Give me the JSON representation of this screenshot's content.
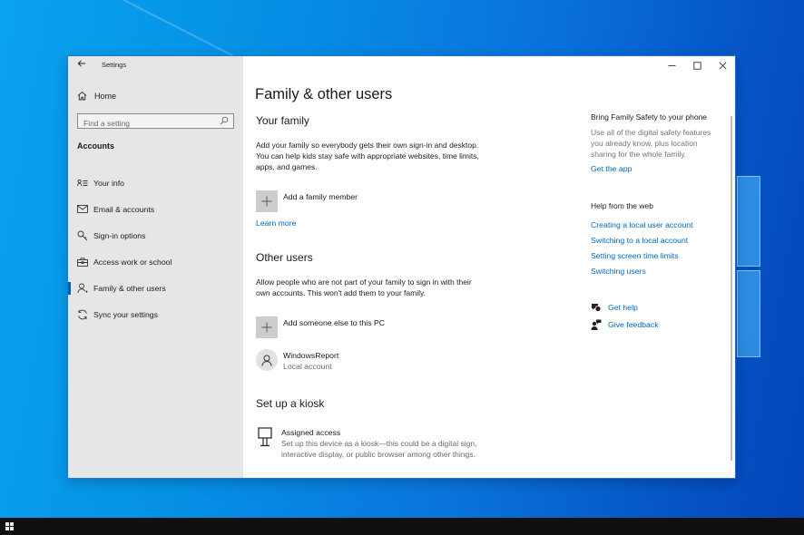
{
  "window": {
    "title": "Settings",
    "controls": {
      "minimize": "minimize",
      "maximize": "maximize",
      "close": "close"
    }
  },
  "sidebar": {
    "home_label": "Home",
    "search": {
      "placeholder": "Find a setting",
      "value": ""
    },
    "section_label": "Accounts",
    "items": [
      {
        "label": "Your info",
        "icon": "contact-info-icon",
        "active": false
      },
      {
        "label": "Email & accounts",
        "icon": "mail-icon",
        "active": false
      },
      {
        "label": "Sign-in options",
        "icon": "key-icon",
        "active": false
      },
      {
        "label": "Access work or school",
        "icon": "briefcase-icon",
        "active": false
      },
      {
        "label": "Family & other users",
        "icon": "person-add-icon",
        "active": true
      },
      {
        "label": "Sync your settings",
        "icon": "sync-icon",
        "active": false
      }
    ],
    "accent_color": "#0063b1"
  },
  "main": {
    "page_title": "Family & other users",
    "your_family": {
      "heading": "Your family",
      "description_lines": [
        "Add your family so everybody gets their own sign-in and desktop.",
        "You can help kids stay safe with appropriate websites, time limits,",
        "apps, and games."
      ],
      "add_label": "Add a family member",
      "learn_more": "Learn more"
    },
    "other_users": {
      "heading": "Other users",
      "description_lines": [
        "Allow people who are not part of your family to sign in with their",
        "own accounts. This won't add them to your family."
      ],
      "add_label": "Add someone else to this PC",
      "users": [
        {
          "name": "WindowsReport",
          "type": "Local account"
        }
      ]
    },
    "kiosk": {
      "heading": "Set up a kiosk",
      "item_title": "Assigned access",
      "item_desc_lines": [
        "Set up this device as a kiosk—this could be a digital sign,",
        "interactive display, or public browser among other things."
      ]
    }
  },
  "side_panel": {
    "family_safety": {
      "title": "Bring Family Safety to your phone",
      "text_lines": [
        "Use all of the digital safety features",
        "you already know, plus location",
        "sharing for the whole family."
      ],
      "link": "Get the app"
    },
    "help": {
      "title": "Help from the web",
      "links": [
        "Creating a local user account",
        "Switching to a local account",
        "Setting screen time limits",
        "Switching users"
      ]
    },
    "actions": {
      "get_help": "Get help",
      "give_feedback": "Give feedback"
    },
    "link_color": "#0067b8"
  },
  "taskbar": {
    "start_label": "Start"
  }
}
